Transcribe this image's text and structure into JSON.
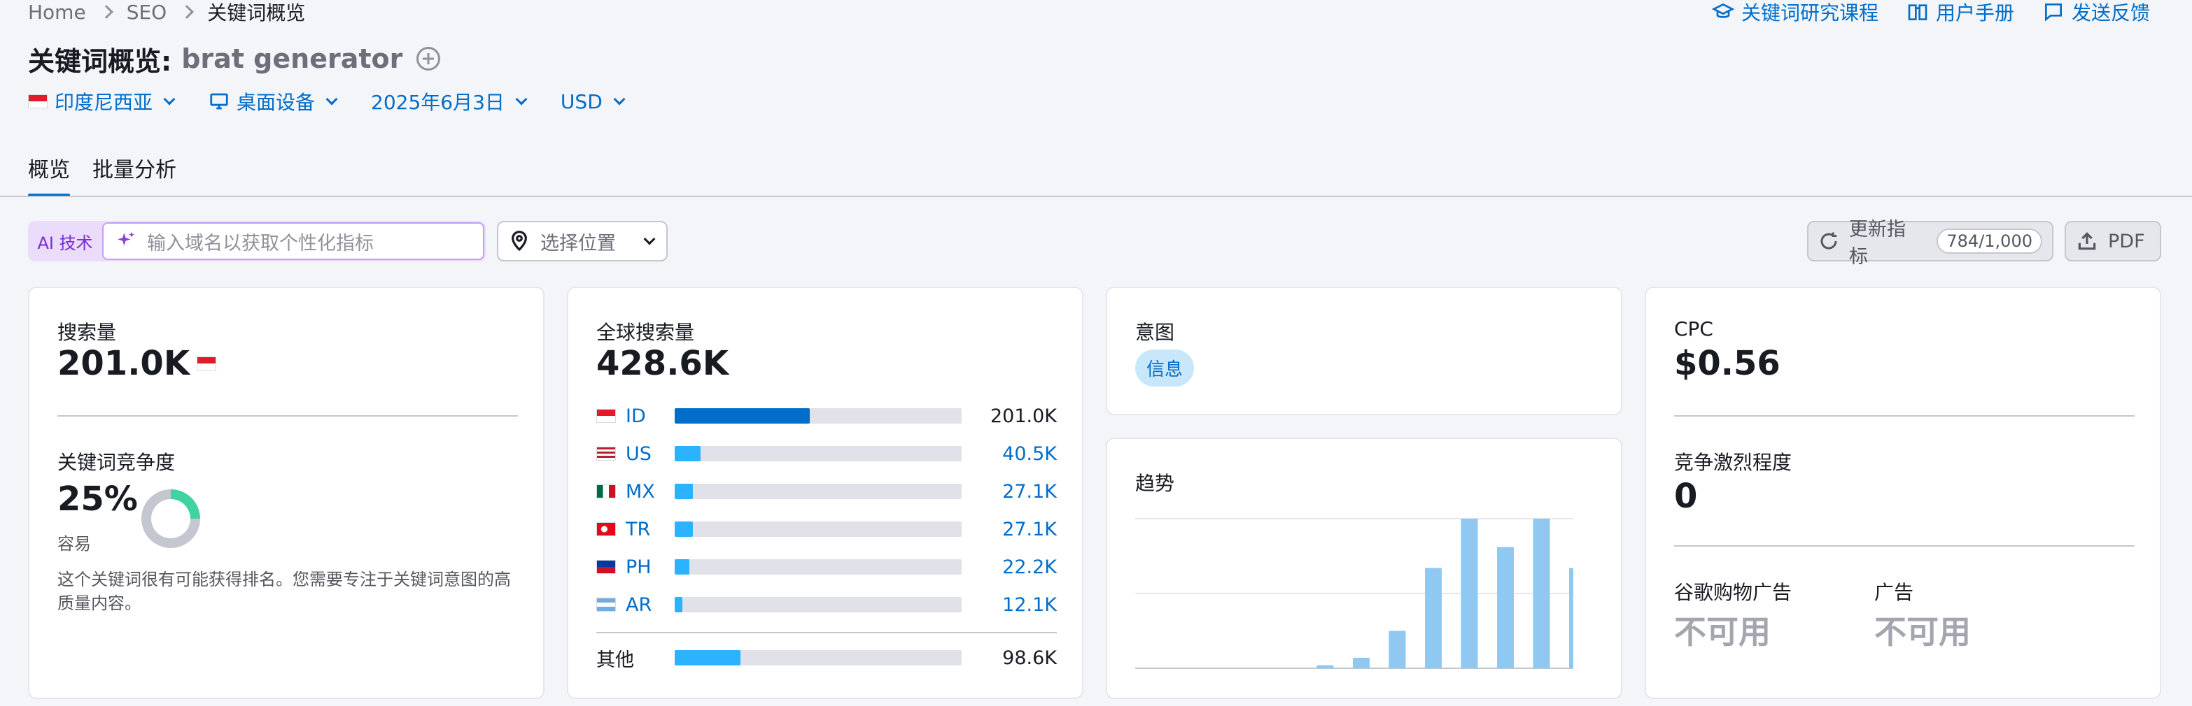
{
  "breadcrumb": {
    "items": [
      "Home",
      "SEO",
      "关键词概览"
    ]
  },
  "toplinks": {
    "course": "关键词研究课程",
    "manual": "用户手册",
    "feedback": "发送反馈"
  },
  "title": {
    "prefix": "关键词概览:",
    "keyword": "brat generator"
  },
  "filters": {
    "country": "印度尼西亚",
    "device": "桌面设备",
    "date": "2025年6月3日",
    "currency": "USD"
  },
  "tabs": [
    "概览",
    "批量分析"
  ],
  "toolbar": {
    "ai_badge": "AI 技术",
    "ai_placeholder": "输入域名以获取个性化指标",
    "location": "选择位置",
    "refresh": "更新指标",
    "refresh_count": "784/1,000",
    "pdf": "PDF"
  },
  "volume": {
    "label": "搜索量",
    "value": "201.0K",
    "difficulty_label": "关键词竞争度",
    "difficulty_value": "25%",
    "difficulty_percent": 25,
    "difficulty_level": "容易",
    "description": "这个关键词很有可能获得排名。您需要专注于关键词意图的高质量内容。"
  },
  "global": {
    "label": "全球搜索量",
    "value": "428.6K",
    "countries": [
      {
        "code": "ID",
        "value": "201.0K",
        "share": 0.47,
        "primary": true
      },
      {
        "code": "US",
        "value": "40.5K",
        "share": 0.09,
        "primary": false
      },
      {
        "code": "MX",
        "value": "27.1K",
        "share": 0.063,
        "primary": false
      },
      {
        "code": "TR",
        "value": "27.1K",
        "share": 0.063,
        "primary": false
      },
      {
        "code": "PH",
        "value": "22.2K",
        "share": 0.052,
        "primary": false
      },
      {
        "code": "AR",
        "value": "12.1K",
        "share": 0.028,
        "primary": false
      }
    ],
    "other_label": "其他",
    "other_value": "98.6K",
    "other_share": 0.23
  },
  "intent": {
    "label": "意图",
    "tag": "信息"
  },
  "trend": {
    "label": "趋势",
    "values": [
      0,
      0,
      0,
      0,
      0,
      2,
      7,
      25,
      67,
      100,
      81,
      100,
      67
    ]
  },
  "cpc": {
    "label": "CPC",
    "value": "$0.56",
    "competition_label": "竞争激烈程度",
    "competition_value": "0",
    "shopping_label": "谷歌购物广告",
    "shopping_value": "不可用",
    "ads_label": "广告",
    "ads_value": "不可用"
  },
  "colors": {
    "primary_blue": "#006dca",
    "light_blue": "#2bb3ff",
    "trend_bar": "#8fc8f0",
    "track": "#e0e1e9",
    "easy_green": "#3fd3a0"
  }
}
